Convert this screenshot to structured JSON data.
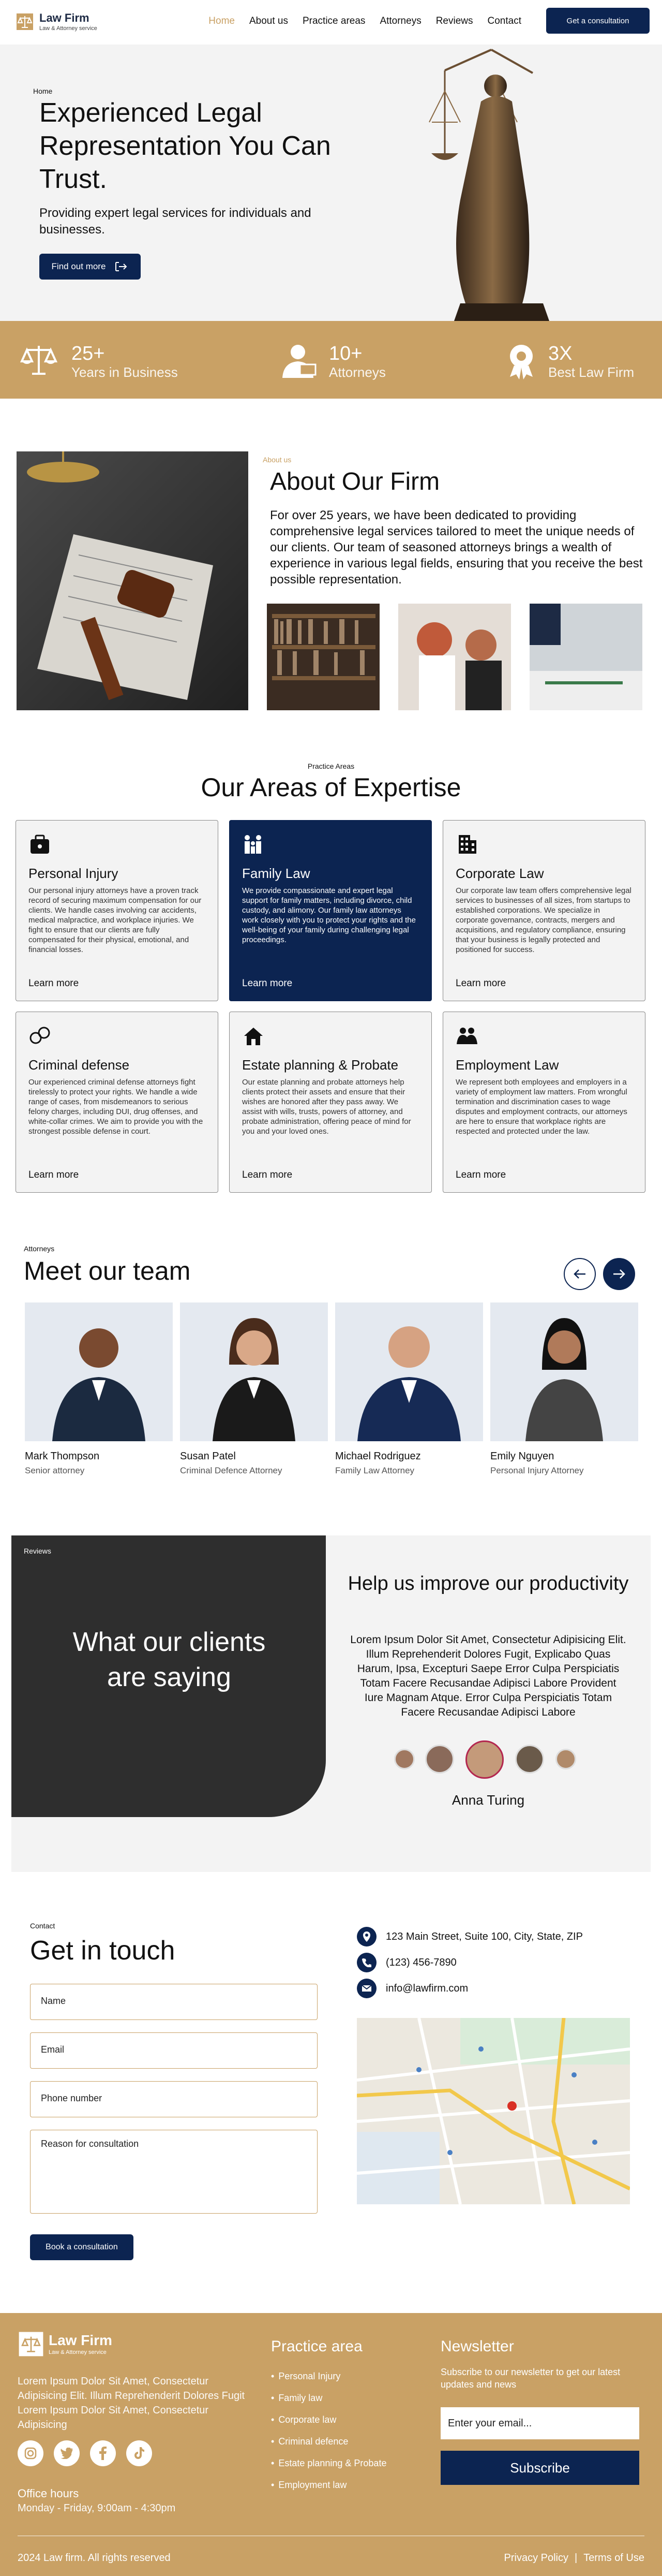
{
  "header": {
    "logo_title": "Law Firm",
    "logo_sub": "Law & Attorney service",
    "nav": [
      "Home",
      "About us",
      "Practice areas",
      "Attorneys",
      "Reviews",
      "Contact"
    ],
    "cta": "Get a consultation"
  },
  "hero": {
    "breadcrumb": "Home",
    "title": "Experienced Legal Representation You Can Trust.",
    "subtitle": "Providing expert legal services for individuals and businesses.",
    "button": "Find out more"
  },
  "stats": [
    {
      "num": "25+",
      "label": "Years in Business"
    },
    {
      "num": "10+",
      "label": "Attorneys"
    },
    {
      "num": "3X",
      "label": "Best Law Firm"
    }
  ],
  "about": {
    "tag": "About us",
    "title": "About Our Firm",
    "text": "For over 25 years, we have been dedicated to providing comprehensive legal services tailored to meet the unique needs of our clients. Our team of seasoned attorneys brings a wealth of experience in various legal fields, ensuring that you receive the best possible representation."
  },
  "practice": {
    "tag": "Practice Areas",
    "title": "Our Areas of Expertise",
    "learn_more": "Learn more",
    "cards": [
      {
        "title": "Personal Injury",
        "icon": "briefcase-icon",
        "text": "Our personal injury attorneys have a proven track record of securing maximum compensation for our clients. We handle cases involving car accidents, medical malpractice, and workplace injuries. We fight to ensure that our clients are fully compensated for their physical, emotional, and financial losses."
      },
      {
        "title": "Family Law",
        "icon": "family-icon",
        "text": "We provide compassionate and expert legal support for family matters, including divorce, child custody, and alimony. Our family law attorneys work closely with you to protect your rights and the well-being of your family during challenging legal proceedings."
      },
      {
        "title": "Corporate Law",
        "icon": "building-icon",
        "text": "Our corporate law team offers comprehensive legal services to businesses of all sizes, from startups to established corporations. We specialize in corporate governance, contracts, mergers and acquisitions, and regulatory compliance, ensuring that your business is legally protected and positioned for success."
      },
      {
        "title": "Criminal defense",
        "icon": "handcuffs-icon",
        "text": "Our experienced criminal defense attorneys fight tirelessly to protect your rights. We handle a wide range of cases, from misdemeanors to serious felony charges, including DUI, drug offenses, and white-collar crimes. We aim to provide you with the strongest possible defense in court."
      },
      {
        "title": "Estate planning & Probate",
        "icon": "house-icon",
        "text": "Our estate planning and probate attorneys help clients protect their assets and ensure that their wishes are honored after they pass away. We assist with wills, trusts, powers of attorney, and probate administration, offering peace of mind for you and your loved ones."
      },
      {
        "title": "Employment Law",
        "icon": "team-icon",
        "text": "We represent both employees and employers in a variety of employment law matters. From wrongful termination and discrimination cases to wage disputes and employment contracts, our attorneys are here to ensure that workplace rights are respected and protected under the law."
      }
    ]
  },
  "team": {
    "tag": "Attorneys",
    "title": "Meet our team",
    "members": [
      {
        "name": "Mark Thompson",
        "role": "Senior attorney"
      },
      {
        "name": "Susan Patel",
        "role": "Criminal Defence Attorney"
      },
      {
        "name": "Michael Rodriguez",
        "role": "Family Law Attorney"
      },
      {
        "name": "Emily Nguyen",
        "role": "Personal Injury Attorney"
      }
    ]
  },
  "reviews": {
    "tag": "Reviews",
    "heading": "What our clients are saying",
    "title": "Help us improve our productivity",
    "text": "Lorem Ipsum Dolor Sit Amet, Consectetur Adipisicing Elit. Illum Reprehenderit Dolores Fugit, Explicabo Quas Harum, Ipsa, Excepturi Saepe Error Culpa Perspiciatis Totam Facere Recusandae Adipisci Labore Provident Iure Magnam Atque. Error Culpa Perspiciatis Totam Facere Recusandae Adipisci Labore",
    "name": "Anna Turing"
  },
  "contact": {
    "tag": "Contact",
    "title": "Get in touch",
    "fields": [
      "Name",
      "Email",
      "Phone number",
      "Reason for consultation"
    ],
    "button": "Book a consultation",
    "address": "123 Main Street, Suite 100, City, State, ZIP",
    "phone": "(123) 456-7890",
    "email": "info@lawfirm.com"
  },
  "footer": {
    "logo_title": "Law Firm",
    "logo_sub": "Law & Attorney service",
    "about": "Lorem Ipsum Dolor Sit Amet, Consectetur Adipisicing Elit. Illum Reprehenderit Dolores Fugit Lorem Ipsum Dolor Sit Amet, Consectetur Adipisicing",
    "hours_title": "Office hours",
    "hours": "Monday - Friday, 9:00am - 4:30pm",
    "practice_title": "Practice area",
    "practice_items": [
      "Personal Injury",
      "Family law",
      "Corporate law",
      "Criminal defence",
      "Estate planning & Probate",
      "Employment law"
    ],
    "newsletter_title": "Newsletter",
    "newsletter_text": "Subscribe to our newsletter to get our latest updates and news",
    "newsletter_placeholder": "Enter your email...",
    "subscribe": "Subscribe",
    "copyright": "2024 Law firm. All rights reserved",
    "privacy": "Privacy Policy",
    "terms": "Terms of Use"
  },
  "colors": {
    "gold": "#c9a165",
    "navy": "#0c2451",
    "dark": "#2e2e2e"
  }
}
